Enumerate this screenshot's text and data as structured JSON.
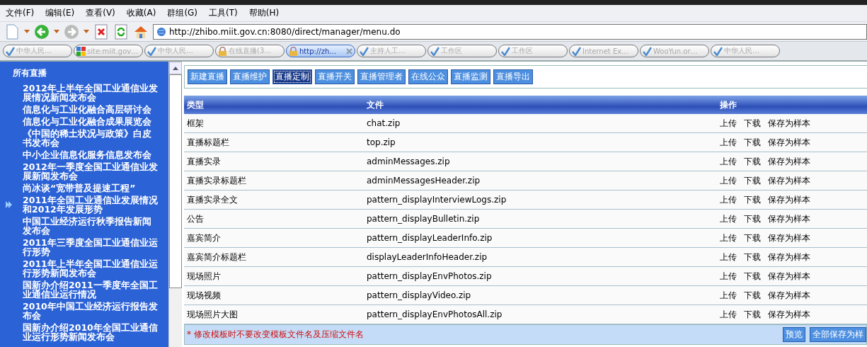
{
  "menu_bar": [
    "文件(F)",
    "编辑(E)",
    "查看(V)",
    "收藏(A)",
    "群组(G)",
    "工具(T)",
    "帮助(H)"
  ],
  "toolbar": {
    "address": "http://zhibo.miit.gov.cn:8080/direct/manager/menu.do"
  },
  "tabs": [
    {
      "label": "中华人民…",
      "kind": "check",
      "selected": false
    },
    {
      "label": "site:miit.gov…",
      "kind": "google",
      "selected": false
    },
    {
      "label": "中华人民…",
      "kind": "check",
      "selected": false
    },
    {
      "label": "在线直播(3…",
      "kind": "lock",
      "selected": false
    },
    {
      "label": "http://zh…",
      "kind": "lock",
      "selected": true
    },
    {
      "label": "主持人工…",
      "kind": "check",
      "selected": false
    },
    {
      "label": "工作区",
      "kind": "check",
      "selected": false
    },
    {
      "label": "工作区",
      "kind": "check",
      "selected": false
    },
    {
      "label": "Internet Ex…",
      "kind": "check",
      "selected": false
    },
    {
      "label": "WooYun.or…",
      "kind": "check",
      "selected": false
    },
    {
      "label": "中华人民…",
      "kind": "check",
      "selected": false
    }
  ],
  "sidebar": {
    "title": "所有直播",
    "items": [
      {
        "label": "2012年上半年全国工业通信业发展情况新闻发布会",
        "selected": false
      },
      {
        "label": "信息化与工业化融合高层研讨会",
        "selected": false
      },
      {
        "label": "信息化与工业化融合成果展览会",
        "selected": false
      },
      {
        "label": "《中国的稀土状况与政策》白皮书发布会",
        "selected": false
      },
      {
        "label": "中小企业信息化服务信息发布会",
        "selected": false
      },
      {
        "label": "2012年一季度全国工业通信业发展新闻发布会",
        "selected": false
      },
      {
        "label": "尚冰谈“宽带普及提速工程”",
        "selected": false
      },
      {
        "label": "2011年全国工业通信业发展情况和2012年发展形势",
        "selected": true
      },
      {
        "label": "中国工业经济运行秋季报告新闻发布会",
        "selected": false
      },
      {
        "label": "2011年三季度全国工业通信业运行形势",
        "selected": false
      },
      {
        "label": "2011年上半年全国工业通信业运行形势新闻发布会",
        "selected": false
      },
      {
        "label": "国新办介绍2011一季度年全国工业通信业运行情况",
        "selected": false
      },
      {
        "label": "2010年中国工业经济运行报告发布会",
        "selected": false
      },
      {
        "label": "国新办介绍2010年全国工业通信业运行形势新闻发布会",
        "selected": false
      }
    ]
  },
  "nav_buttons": [
    {
      "label": "新建直播",
      "selected": false
    },
    {
      "label": "直播维护",
      "selected": false
    },
    {
      "label": "直播定制",
      "selected": true
    },
    {
      "label": "直播开关",
      "selected": false
    },
    {
      "label": "直播管理者",
      "selected": false
    },
    {
      "label": "在线公众",
      "selected": false
    },
    {
      "label": "直播监测",
      "selected": false
    },
    {
      "label": "直播导出",
      "selected": false
    }
  ],
  "table": {
    "columns": [
      "类型",
      "文件",
      "操作"
    ],
    "rows": [
      {
        "type": "框架",
        "file": "chat.zip",
        "actions": [
          "上传",
          "下载",
          "保存为样本"
        ]
      },
      {
        "type": "直播标题栏",
        "file": "top.zip",
        "actions": [
          "上传",
          "下载",
          "保存为样本"
        ]
      },
      {
        "type": "直播实录",
        "file": "adminMessages.zip",
        "actions": [
          "上传",
          "下载",
          "保存为样本"
        ]
      },
      {
        "type": "直播实录标题栏",
        "file": "adminMessagesHeader.zip",
        "actions": [
          "上传",
          "下载",
          "保存为样本"
        ]
      },
      {
        "type": "直播实录全文",
        "file": "pattern_displayInterviewLogs.zip",
        "actions": [
          "上传",
          "下载",
          "保存为样本"
        ]
      },
      {
        "type": "公告",
        "file": "pattern_displayBulletin.zip",
        "actions": [
          "上传",
          "下载",
          "保存为样本"
        ]
      },
      {
        "type": "嘉宾简介",
        "file": "pattern_displayLeaderInfo.zip",
        "actions": [
          "上传",
          "下载",
          "保存为样本"
        ]
      },
      {
        "type": "嘉宾简介标题栏",
        "file": "displayLeaderInfoHeader.zip",
        "actions": [
          "上传",
          "下载",
          "保存为样本"
        ]
      },
      {
        "type": "现场照片",
        "file": "pattern_displayEnvPhotos.zip",
        "actions": [
          "上传",
          "下载",
          "保存为样本"
        ]
      },
      {
        "type": "现场视频",
        "file": "pattern_displayVideo.zip",
        "actions": [
          "上传",
          "下载",
          "保存为样本"
        ]
      },
      {
        "type": "现场照片大图",
        "file": "pattern_displayEnvPhotosAll.zip",
        "actions": [
          "上传",
          "下载",
          "保存为样本"
        ]
      }
    ]
  },
  "footer": {
    "note": "* 修改模板时不要改变模板文件名及压缩文件名",
    "buttons": [
      "预览",
      "全部保存为样"
    ]
  }
}
